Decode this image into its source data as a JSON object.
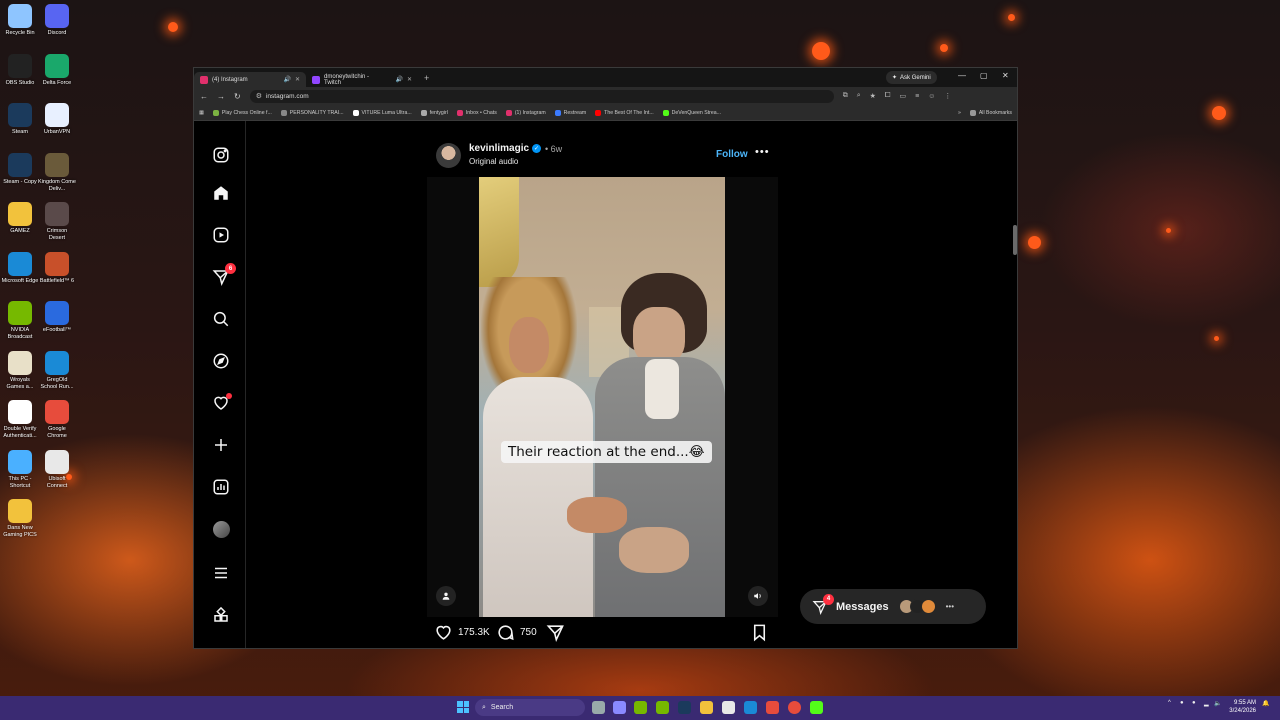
{
  "desktop": {
    "icons": [
      {
        "label": "Recycle Bin",
        "color": "#8ec5ff"
      },
      {
        "label": "Discord",
        "color": "#5865f2"
      },
      {
        "label": "OBS Studio",
        "color": "#222222"
      },
      {
        "label": "Delta Force",
        "color": "#1aa86b"
      },
      {
        "label": "Steam",
        "color": "#1b3a5c"
      },
      {
        "label": "UrbanVPN",
        "color": "#e8f0ff"
      },
      {
        "label": "Steam - Copy",
        "color": "#1b3a5c"
      },
      {
        "label": "Kingdom Come Deliv...",
        "color": "#6a5a3a"
      },
      {
        "label": "GAMEZ",
        "color": "#f2c23c"
      },
      {
        "label": "Crimson Desert",
        "color": "#5a4a4a"
      },
      {
        "label": "Microsoft Edge",
        "color": "#1a8ad6"
      },
      {
        "label": "Battlefield™ 6",
        "color": "#c8502a"
      },
      {
        "label": "NVIDIA Broadcast",
        "color": "#76b900"
      },
      {
        "label": "eFootball™",
        "color": "#2a6adf"
      },
      {
        "label": "Wroyals Games a...",
        "color": "#e8e0c8"
      },
      {
        "label": "GregOld School Run...",
        "color": "#1a8ad6"
      },
      {
        "label": "Double Verify Authenticati...",
        "color": "#ffffff"
      },
      {
        "label": "Google Chrome",
        "color": "#e74c3c"
      },
      {
        "label": "This PC - Shortcut",
        "color": "#4ab0ff"
      },
      {
        "label": "Ubisoft Connect",
        "color": "#e8e8e8"
      },
      {
        "label": "Dans New Gaming PICS",
        "color": "#f2c23c"
      }
    ]
  },
  "browser": {
    "tabs": [
      {
        "title": "(4) Instagram",
        "active": true,
        "favicon_color": "#e1306c"
      },
      {
        "title": "dmoneytwitchin - Twitch",
        "active": false,
        "favicon_color": "#9146ff"
      }
    ],
    "new_tab": "+",
    "gemini_label": "Ask Gemini",
    "url": "instagram.com",
    "bookmarks": [
      {
        "label": "Play Chess Online f...",
        "color": "#7cb342"
      },
      {
        "label": "PERSONALITY TRAI...",
        "color": "#888888"
      },
      {
        "label": "VITURE Luma Ultra...",
        "color": "#ffffff"
      },
      {
        "label": "fentygirl",
        "color": "#aaaaaa"
      },
      {
        "label": "Inbox • Chats",
        "color": "#e1306c"
      },
      {
        "label": "(1) Instagram",
        "color": "#e1306c"
      },
      {
        "label": "Restream",
        "color": "#3b7bff"
      },
      {
        "label": "The Best Of The Int...",
        "color": "#ff0000"
      },
      {
        "label": "DeVenQueen Strea...",
        "color": "#53fc18"
      }
    ],
    "bookmarks_overflow": "»",
    "all_bookmarks": "All Bookmarks"
  },
  "instagram": {
    "nav": [
      {
        "name": "instagram-logo-icon",
        "badge": ""
      },
      {
        "name": "home-icon",
        "badge": ""
      },
      {
        "name": "reels-icon",
        "badge": ""
      },
      {
        "name": "direct-messages-icon",
        "badge": "6"
      },
      {
        "name": "search-icon",
        "badge": ""
      },
      {
        "name": "explore-icon",
        "badge": ""
      },
      {
        "name": "notifications-heart-icon",
        "badge": ""
      },
      {
        "name": "create-plus-icon",
        "badge": ""
      },
      {
        "name": "dashboard-icon",
        "badge": ""
      },
      {
        "name": "profile-avatar",
        "badge": ""
      },
      {
        "name": "menu-icon",
        "badge": ""
      },
      {
        "name": "also-from-meta-icon",
        "badge": ""
      }
    ],
    "post": {
      "username": "kevinlimagic",
      "age": "• 6w",
      "audio": "Original audio",
      "follow_label": "Follow",
      "more_label": "•••",
      "caption_overlay": "Their reaction at the end...😂",
      "likes": "175.3K",
      "comments": "750"
    },
    "messages": {
      "label": "Messages",
      "badge": "4",
      "avatar_colors": [
        "#b89a7a",
        "#222222",
        "#e08a3a"
      ]
    }
  },
  "taskbar": {
    "search_placeholder": "Search",
    "clock_time": "9:55 AM",
    "clock_date": "3/24/2026",
    "app_colors": [
      "#f2c23c",
      "#76b900",
      "#8a8aff",
      "#1a8ad6",
      "#4ab0ff",
      "#e74c3c",
      "#53fc18"
    ]
  }
}
